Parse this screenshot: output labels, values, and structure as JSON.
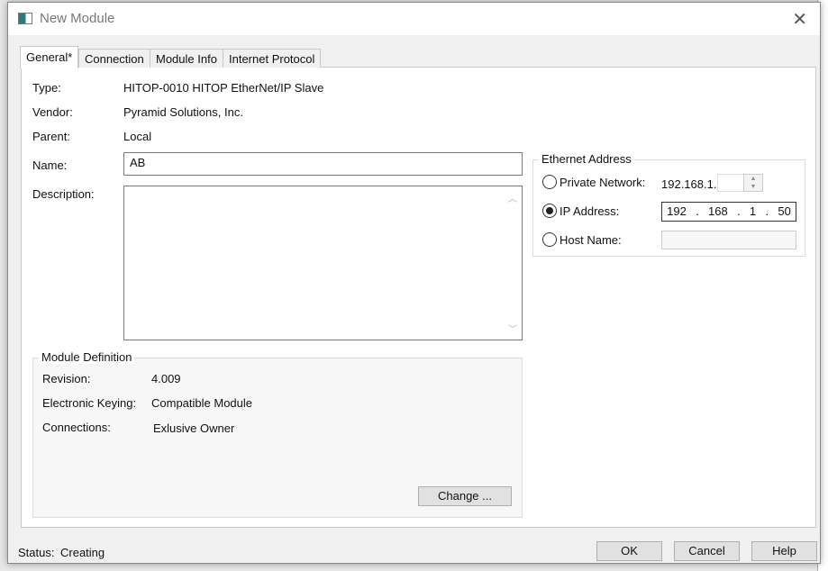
{
  "window": {
    "title": "New Module",
    "close": "✕"
  },
  "tabs": [
    {
      "label": "General*"
    },
    {
      "label": "Connection"
    },
    {
      "label": "Module Info"
    },
    {
      "label": "Internet Protocol"
    }
  ],
  "general": {
    "type_label": "Type:",
    "type_value": "HITOP-0010 HITOP EtherNet/IP Slave",
    "vendor_label": "Vendor:",
    "vendor_value": "Pyramid Solutions, Inc.",
    "parent_label": "Parent:",
    "parent_value": "Local",
    "name_label": "Name:",
    "name_value": "AB",
    "description_label": "Description:",
    "description_value": ""
  },
  "module_definition": {
    "title": "Module Definition",
    "revision_label": "Revision:",
    "revision_value": "4.009",
    "keying_label": "Electronic Keying:",
    "keying_value": "Compatible Module",
    "connections_label": "Connections:",
    "connections_value": "Exlusive Owner",
    "change_button": "Change ..."
  },
  "ethernet": {
    "title": "Ethernet Address",
    "private_label": "Private Network:",
    "private_prefix": "192.168.1.",
    "private_value": "",
    "ip_label": "IP Address:",
    "ip": [
      "192",
      "168",
      "1",
      "50"
    ],
    "host_label": "Host Name:",
    "host_value": "",
    "selected": "ip"
  },
  "footer": {
    "status_label": "Status:",
    "status_value": "Creating",
    "ok": "OK",
    "cancel": "Cancel",
    "help": "Help"
  }
}
